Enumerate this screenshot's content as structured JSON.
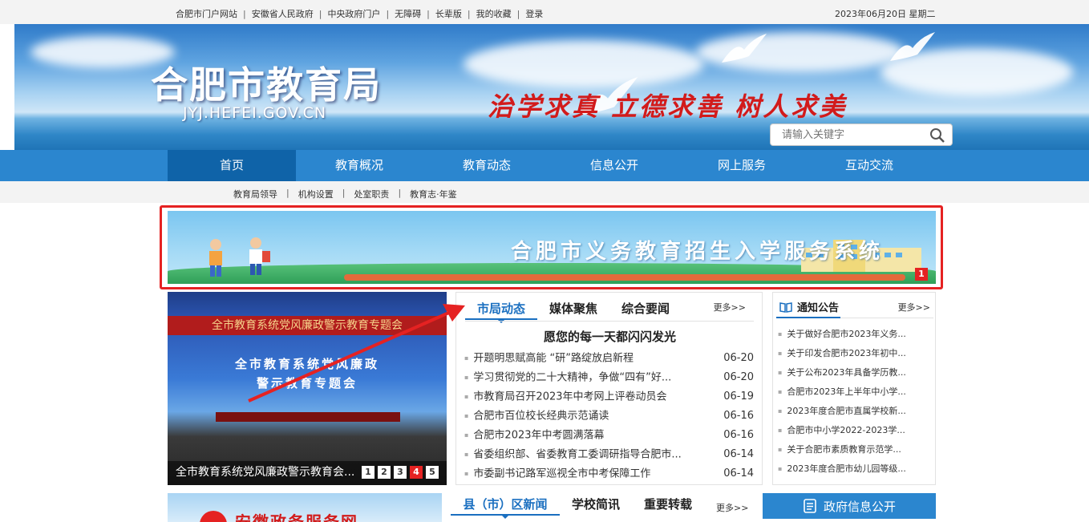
{
  "topbar": {
    "links": [
      "合肥市门户网站",
      "安徽省人民政府",
      "中央政府门户",
      "无障碍",
      "长辈版",
      "我的收藏",
      "登录"
    ],
    "date": "2023年06月20日 星期二"
  },
  "header": {
    "site_title": "合肥市教育局",
    "site_url": "JYJ.HEFEI.GOV.CN",
    "slogan": "治学求真 立德求善 树人求美",
    "search_placeholder": "请输入关键字"
  },
  "nav": {
    "items": [
      "首页",
      "教育概况",
      "教育动态",
      "信息公开",
      "网上服务",
      "互动交流"
    ],
    "active": "首页"
  },
  "subnav": {
    "items": [
      "教育局领导",
      "机构设置",
      "处室职责",
      "教育志·年鉴"
    ]
  },
  "promo": {
    "title": "合肥市义务教育招生入学服务系统",
    "index": "1"
  },
  "slider": {
    "banner_text": "全市教育系统党风廉政警示教育专题会",
    "screen_line1": "全市教育系统党风廉政",
    "screen_line2": "警示教育专题会",
    "caption": "全市教育系统党风廉政警示教育会...",
    "pages": [
      "1",
      "2",
      "3",
      "4",
      "5"
    ],
    "active_page": "4"
  },
  "news": {
    "tabs": [
      "市局动态",
      "媒体聚焦",
      "综合要闻"
    ],
    "more": "更多>>",
    "headline": "愿您的每一天都闪闪发光",
    "items": [
      {
        "title": "开题明思赋高能 “研”路绽放启新程",
        "date": "06-20"
      },
      {
        "title": "学习贯彻党的二十大精神，争做“四有”好...",
        "date": "06-20"
      },
      {
        "title": "市教育局召开2023年中考网上评卷动员会",
        "date": "06-19"
      },
      {
        "title": "合肥市百位校长经典示范诵读",
        "date": "06-16"
      },
      {
        "title": "合肥市2023年中考圆满落幕",
        "date": "06-16"
      },
      {
        "title": "省委组织部、省委教育工委调研指导合肥市...",
        "date": "06-14"
      },
      {
        "title": "市委副书记路军巡视全市中考保障工作",
        "date": "06-14"
      }
    ]
  },
  "notice": {
    "title": "通知公告",
    "more": "更多>>",
    "items": [
      "关于做好合肥市2023年义务...",
      "关于印发合肥市2023年初中...",
      "关于公布2023年具备学历教...",
      "合肥市2023年上半年中小学...",
      "2023年度合肥市直属学校新...",
      "合肥市中小学2022-2023学...",
      "关于合肥市素质教育示范学...",
      "2023年度合肥市幼儿园等级..."
    ]
  },
  "bottom": {
    "service_text": "安徽政务服务网",
    "tabs": [
      "县（市）区新闻",
      "学校简讯",
      "重要转载"
    ],
    "more": "更多>>",
    "gov_info": "政府信息公开"
  },
  "colors": {
    "nav_blue": "#2b86cf",
    "nav_active": "#0f63a8",
    "accent_red": "#e52222",
    "tab_blue": "#1a6fc0"
  }
}
